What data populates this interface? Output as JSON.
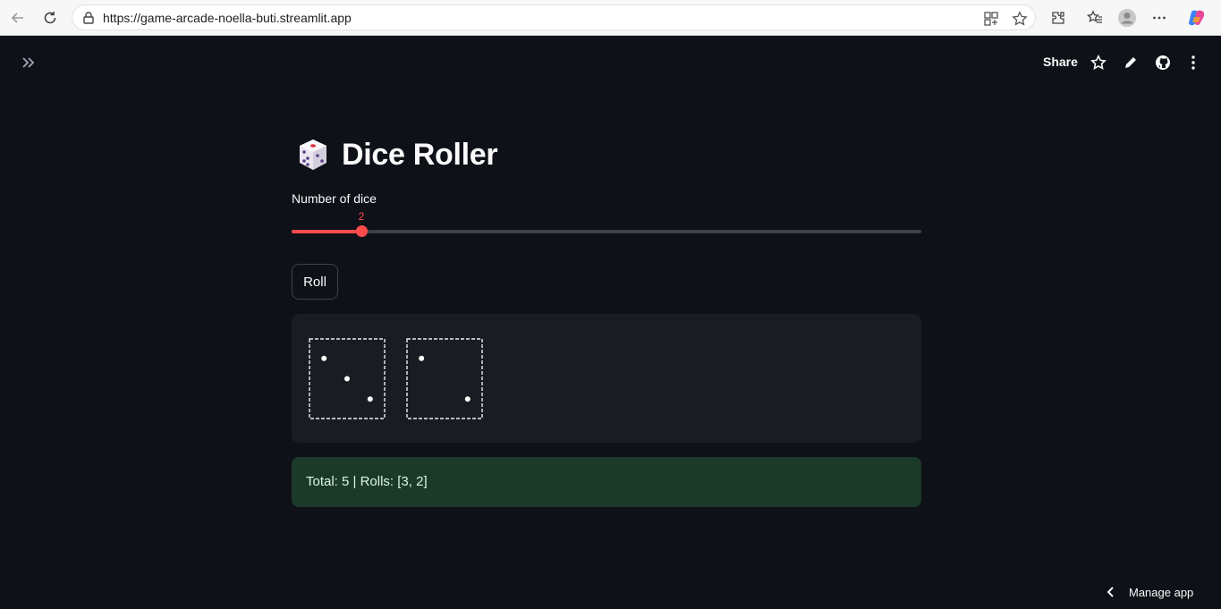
{
  "browser": {
    "url": "https://game-arcade-noella-buti.streamlit.app"
  },
  "header": {
    "share_label": "Share"
  },
  "main": {
    "title": "Dice Roller",
    "slider": {
      "label": "Number of dice",
      "value": "2",
      "min": 1,
      "max": 10,
      "fraction": 0.111
    },
    "roll_button_label": "Roll",
    "dice": [
      3,
      2
    ],
    "result_text": "Total: 5 | Rolls: [3, 2]"
  },
  "footer": {
    "manage_app_label": "Manage app"
  },
  "colors": {
    "accent": "#ff4b4b",
    "background": "#0e1117",
    "panel": "#1a1c23",
    "success_bg": "#1b3a2a"
  }
}
